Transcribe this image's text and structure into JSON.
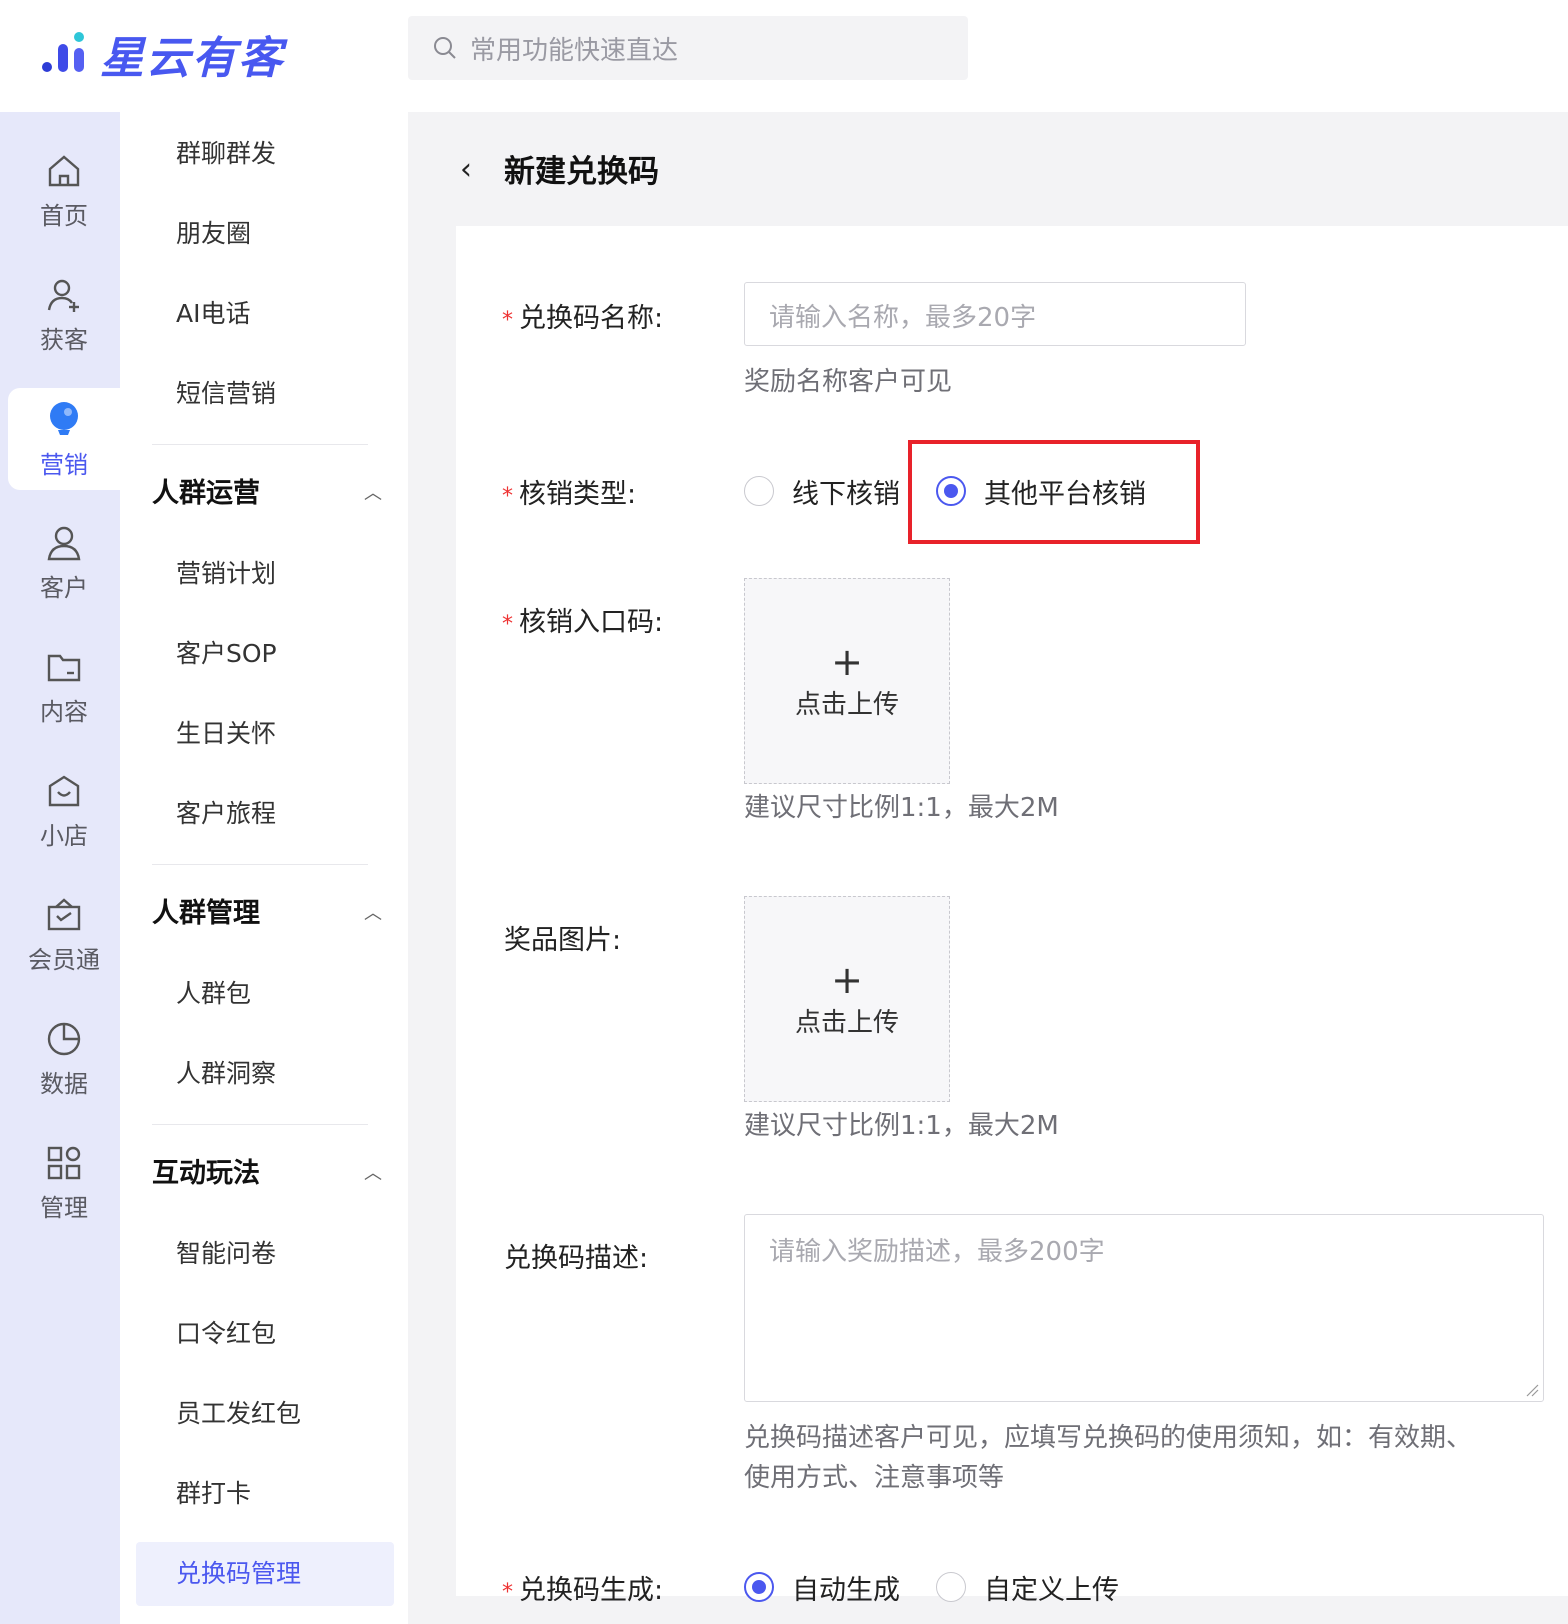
{
  "app": {
    "brand": "星云有客",
    "search_placeholder": "常用功能快速直达",
    "colors": {
      "accent": "#4b58ef",
      "required": "#e33333",
      "highlight_box": "#e8222a"
    }
  },
  "rail": {
    "items": [
      {
        "label": "首页",
        "icon": "home-icon"
      },
      {
        "label": "获客",
        "icon": "user-add-icon"
      },
      {
        "label": "营销",
        "icon": "marketing-icon",
        "active": true
      },
      {
        "label": "客户",
        "icon": "user-icon"
      },
      {
        "label": "内容",
        "icon": "folder-icon"
      },
      {
        "label": "小店",
        "icon": "shop-icon"
      },
      {
        "label": "会员通",
        "icon": "member-icon"
      },
      {
        "label": "数据",
        "icon": "pie-chart-icon"
      },
      {
        "label": "管理",
        "icon": "apps-icon"
      }
    ]
  },
  "submenu": {
    "top_items": [
      "群聊群发",
      "朋友圈",
      "AI电话",
      "短信营销"
    ],
    "groups": [
      {
        "title": "人群运营",
        "items": [
          "营销计划",
          "客户SOP",
          "生日关怀",
          "客户旅程"
        ]
      },
      {
        "title": "人群管理",
        "items": [
          "人群包",
          "人群洞察"
        ]
      },
      {
        "title": "互动玩法",
        "items": [
          "智能问卷",
          "口令红包",
          "员工发红包",
          "群打卡",
          "兑换码管理"
        ]
      }
    ],
    "active_item": "兑换码管理"
  },
  "page": {
    "back_glyph": "‹",
    "title": "新建兑换码"
  },
  "form": {
    "name": {
      "label": "兑换码名称:",
      "placeholder": "请输入名称，最多20字",
      "hint": "奖励名称客户可见"
    },
    "verify_type": {
      "label": "核销类型:",
      "options": [
        "线下核销",
        "其他平台核销"
      ],
      "selected": "其他平台核销"
    },
    "verify_entry": {
      "label": "核销入口码:",
      "upload_plus": "+",
      "upload_text": "点击上传",
      "hint": "建议尺寸比例1:1，最大2M"
    },
    "prize_image": {
      "label": "奖品图片:",
      "upload_plus": "+",
      "upload_text": "点击上传",
      "hint": "建议尺寸比例1:1，最大2M"
    },
    "description": {
      "label": "兑换码描述:",
      "placeholder": "请输入奖励描述，最多200字",
      "hint_line1": "兑换码描述客户可见，应填写兑换码的使用须知，如：有效期、",
      "hint_line2": "使用方式、注意事项等"
    },
    "generation": {
      "label": "兑换码生成:",
      "options": [
        "自动生成",
        "自定义上传"
      ],
      "selected": "自动生成"
    },
    "required_mark": "*"
  }
}
